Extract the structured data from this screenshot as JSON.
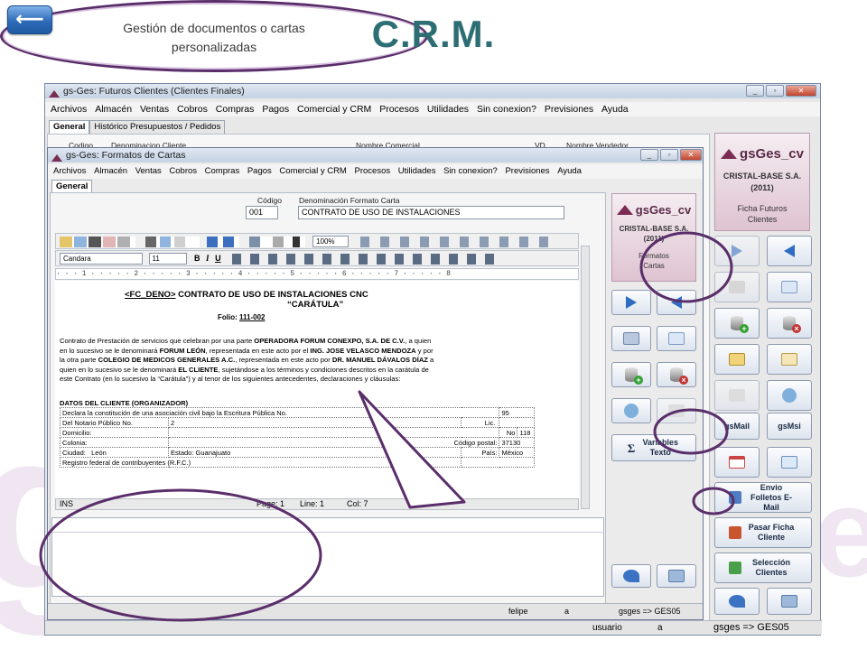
{
  "slide": {
    "title": "C.R.M.",
    "back_symbol": "⟵",
    "watermark_left": "g",
    "watermark_right": "e"
  },
  "outer_window": {
    "title": "gs-Ges: Futuros Clientes (Clientes Finales)",
    "menu": [
      "Archivos",
      "Almacén",
      "Ventas",
      "Cobros",
      "Compras",
      "Pagos",
      "Comercial y CRM",
      "Procesos",
      "Utilidades",
      "Sin conexion?",
      "Previsiones",
      "Ayuda"
    ],
    "tabs": [
      "General",
      "Histórico Presupuestos / Pedidos"
    ],
    "columns": [
      "Codigo",
      "Denominacion Cliente",
      "Nombre Comercial",
      "VD",
      "Nombre Vendedor"
    ],
    "brand": {
      "logo": "gsGes_cv",
      "company": "CRISTAL-BASE S.A.",
      "year": "(2011)",
      "subtitle": "Ficha Futuros Clientes"
    },
    "buttons": {
      "gsmail": "gsMail",
      "gsmsi": "gsMsi",
      "envio_folletos": "Envio Folletos E-Mail",
      "pasar_ficha": "Pasar Ficha Cliente",
      "seleccion": "Selección Clientes"
    },
    "status": {
      "user_label": "usuario",
      "user_value": "a",
      "db": "gsges => GES05"
    }
  },
  "inner_window": {
    "title": "gs-Ges: Formatos de Cartas",
    "menu": [
      "Archivos",
      "Almacén",
      "Ventas",
      "Cobros",
      "Compras",
      "Pagos",
      "Comercial y CRM",
      "Procesos",
      "Utilidades",
      "Sin conexion?",
      "Previsiones",
      "Ayuda"
    ],
    "tab": "General",
    "codigo_label": "Código",
    "codigo_value": "001",
    "denominacion_label": "Denominación Formato Carta",
    "denominacion_value": "CONTRATO DE USO DE INSTALACIONES",
    "brand": {
      "logo": "gsGes_cv",
      "company": "CRISTAL-BASE S.A.",
      "year": "(2011)",
      "subtitle": "Formatos Cartas"
    },
    "variables_button": "Variables Texto",
    "editor": {
      "zoom": "100%",
      "font": "Candara",
      "size": "11",
      "ruler": "· · · 1 · · · · · 2 · · · · · 3 · · · · · 4 · · · · · 5 · · · · · 6 · · · · · 7 · · · · · 8"
    },
    "document": {
      "heading_tag": "<FC_DENO>",
      "heading_rest": " CONTRATO DE USO DE INSTALACIONES CNC",
      "heading2": "“CARÁTULA”",
      "folio_label": "Folio: ",
      "folio_value": "111-002",
      "paragraph": [
        {
          "t": "Contrato de Prestación de servicios que celebran por una parte ",
          "b": false
        },
        {
          "t": "OPERADORA FORUM CONEXPO, S.A. DE C.V.",
          "b": true
        },
        {
          "t": ", a quien en lo sucesivo se le denominará ",
          "b": false
        },
        {
          "t": "FORUM LEÓN",
          "b": true
        },
        {
          "t": ", representada en este acto por el ",
          "b": false
        },
        {
          "t": "ING. JOSE VELASCO MENDOZA",
          "b": true
        },
        {
          "t": " y por la otra parte ",
          "b": false
        },
        {
          "t": "COLEGIO DE MEDICOS GENERALES A.C.",
          "b": true
        },
        {
          "t": ", representada en este acto por ",
          "b": false
        },
        {
          "t": "DR. MANUEL DÁVALOS DÍAZ",
          "b": true
        },
        {
          "t": " a quien en lo sucesivo se le denominará ",
          "b": false
        },
        {
          "t": "EL CLIENTE",
          "b": true
        },
        {
          "t": ", sujetándose a los términos y condiciones descritos en la carátula de este Contrato (en lo sucesivo la “Carátula”) y al tenor de los siguientes antecedentes, declaraciones y cláusulas:",
          "b": false
        }
      ],
      "datos_heading": "DATOS DEL CLIENTE (ORGANIZADOR)",
      "table": {
        "r1": [
          "Declara la constitución de una asociación civil bajo la Escritura Pública No.",
          "95"
        ],
        "r2": [
          "Del Notario Público No.",
          "2",
          "Lic."
        ],
        "r3": [
          "Domicilio:",
          "No",
          "118"
        ],
        "r4": [
          "Colonia:",
          "Código postal:",
          "37130"
        ],
        "r5": [
          "Ciudad:",
          "León",
          "Estado:",
          "Guanajuato",
          "País:",
          "México"
        ],
        "r6": [
          "Registro federal de contribuyentes (R.F.C.)"
        ]
      }
    },
    "status": {
      "mode": "INS",
      "page": "Page: 1",
      "line": "Line: 1",
      "col": "Col: 7"
    },
    "bottom_status": {
      "user": "felipe",
      "value": "a",
      "db": "gsges => GES05"
    }
  },
  "callout": {
    "line1": "Gestión de documentos o cartas",
    "line2": "personalizadas"
  },
  "colors": {
    "title": "#2c6e74",
    "callout_border": "#5a2e6a",
    "accent_blue": "#2f6cc2"
  }
}
